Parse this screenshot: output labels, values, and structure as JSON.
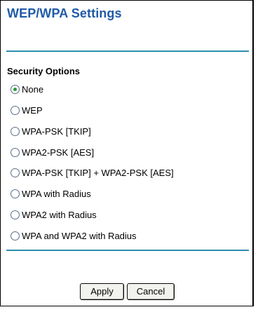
{
  "page": {
    "title": "WEP/WPA Settings"
  },
  "security": {
    "heading": "Security Options",
    "selected": "None",
    "options": [
      {
        "label": "None",
        "checked": true
      },
      {
        "label": "WEP",
        "checked": false
      },
      {
        "label": "WPA-PSK [TKIP]",
        "checked": false
      },
      {
        "label": "WPA2-PSK [AES]",
        "checked": false
      },
      {
        "label": "WPA-PSK [TKIP] + WPA2-PSK [AES]",
        "checked": false
      },
      {
        "label": "WPA with Radius",
        "checked": false
      },
      {
        "label": "WPA2 with Radius",
        "checked": false
      },
      {
        "label": "WPA and WPA2 with Radius",
        "checked": false
      }
    ]
  },
  "buttons": {
    "apply": "Apply",
    "cancel": "Cancel"
  },
  "colors": {
    "title": "#1f5ba7",
    "divider": "#2c8fae",
    "radio_dot": "#2b9a34"
  },
  "icons": {
    "radio_selected": "radio-selected-icon",
    "radio_unselected": "radio-unselected-icon"
  }
}
